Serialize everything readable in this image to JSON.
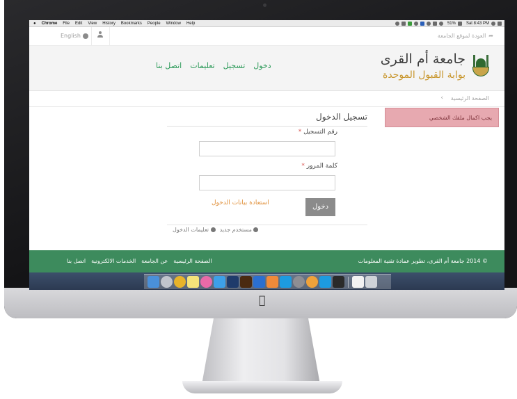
{
  "menubar": {
    "app_name": "Chrome",
    "items": [
      "File",
      "Edit",
      "View",
      "History",
      "Bookmarks",
      "People",
      "Window",
      "Help"
    ],
    "battery": "51%",
    "clock": "Sat 8:43 PM"
  },
  "topbar": {
    "language_label": "English",
    "back_link": "العودة لموقع الجامعة"
  },
  "header": {
    "university_name": "جامعة أم القرى",
    "portal_name": "بوابة القبول الموحدة",
    "nav": [
      "دخول",
      "تسجيل",
      "تعليمات",
      "اتصل بنا"
    ]
  },
  "breadcrumb": {
    "home": "الصفحة الرئيسية"
  },
  "alert": {
    "text": "يجب اكمال ملفك الشخصي"
  },
  "login": {
    "title": "تسجيل الدخول",
    "username_label": "رقم التسجيل",
    "password_label": "كلمة المرور",
    "required_marker": "*",
    "forgot_link": "استعادة بيانات الدخول",
    "submit_label": "دخول",
    "new_user_link": "مستخدم جديد",
    "help_link": "تعليمات الدخول"
  },
  "footer": {
    "copyright": "© 2014 جامعة أم القرى، تطوير عمادة تقنية المعلومات",
    "links": [
      "الصفحة الرئيسية",
      "عن الجامعة",
      "الخدمات الالكترونية",
      "اتصل بنا"
    ]
  },
  "colors": {
    "brand_green": "#3d8b5d",
    "nav_green": "#2e9b5a",
    "accent_gold": "#c8962d",
    "alert_bg": "#e7a9b0"
  },
  "dock": {
    "icons": [
      "finder-icon",
      "launchpad-icon",
      "chrome-icon",
      "notes-icon",
      "itunes-icon",
      "twitter-icon",
      "photoshop-icon",
      "illustrator-icon",
      "teamviewer-icon",
      "sublime-icon",
      "skype-icon",
      "settings-icon",
      "photos-icon",
      "skype-alt-icon",
      "activity-icon",
      "document-icon",
      "trash-icon"
    ]
  }
}
